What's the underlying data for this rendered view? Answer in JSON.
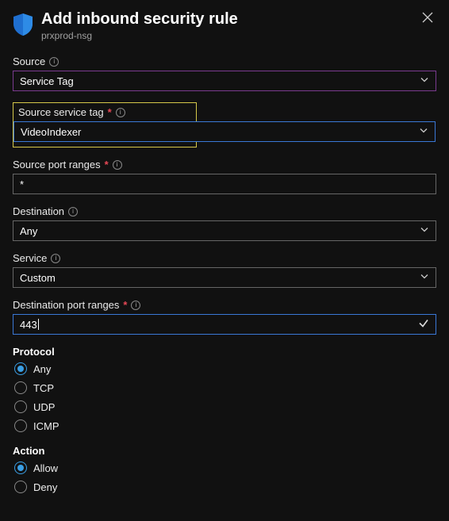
{
  "header": {
    "title": "Add inbound security rule",
    "subtitle": "prxprod-nsg"
  },
  "fields": {
    "source": {
      "label": "Source",
      "value": "Service Tag"
    },
    "service_tag": {
      "label": "Source service tag",
      "value": "VideoIndexer"
    },
    "source_port_ranges": {
      "label": "Source port ranges",
      "value": "*"
    },
    "destination": {
      "label": "Destination",
      "value": "Any"
    },
    "service": {
      "label": "Service",
      "value": "Custom"
    },
    "dest_port_ranges": {
      "label": "Destination port ranges",
      "value": "443"
    }
  },
  "protocol": {
    "label": "Protocol",
    "options": [
      "Any",
      "TCP",
      "UDP",
      "ICMP"
    ],
    "selected": "Any"
  },
  "action": {
    "label": "Action",
    "options": [
      "Allow",
      "Deny"
    ],
    "selected": "Allow"
  }
}
